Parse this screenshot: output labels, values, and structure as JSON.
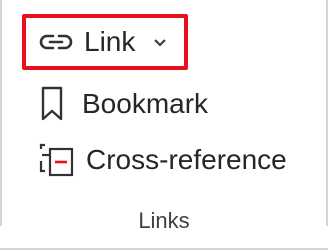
{
  "group": {
    "label": "Links"
  },
  "commands": {
    "link": {
      "label": "Link",
      "icon": "link-icon",
      "dropdown_icon": "chevron-down-icon",
      "highlight_color": "#e8101b"
    },
    "bookmark": {
      "label": "Bookmark",
      "icon": "bookmark-icon"
    },
    "cross_reference": {
      "label": "Cross-reference",
      "icon": "cross-reference-icon"
    }
  }
}
